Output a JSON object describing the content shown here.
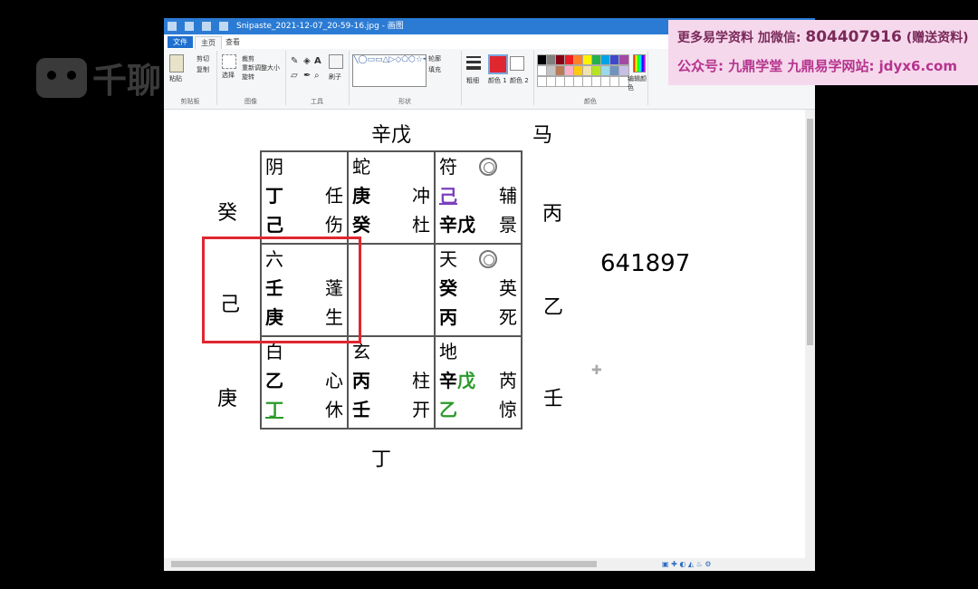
{
  "watermark": {
    "text": "千聊"
  },
  "window": {
    "title": "Snipaste_2021-12-07_20-59-16.jpg - 画图",
    "tabs": {
      "file": "文件",
      "home": "主页",
      "view": "查看"
    },
    "ribbon": {
      "clipboard": {
        "label": "剪贴板",
        "paste": "粘贴",
        "cut": "剪切",
        "copy": "复制"
      },
      "image": {
        "label": "图像",
        "select": "选择",
        "crop": "裁剪",
        "resize": "重新调整大小",
        "rotate": "旋转"
      },
      "tools": {
        "label": "工具",
        "brush": "刷子"
      },
      "shapes": {
        "label": "形状",
        "outline": "轮廓",
        "fill": "填充"
      },
      "size": "粗细",
      "color1": "颜色 1",
      "color2": "颜色 2",
      "colors": {
        "label": "颜色"
      },
      "edit_colors": "编辑颜色"
    }
  },
  "chart": {
    "top": "辛戊",
    "horse": "马",
    "left": {
      "top": "癸",
      "mid": "己",
      "bot": "庚"
    },
    "right": {
      "top": "丙",
      "mid": "乙",
      "bot": "壬"
    },
    "bottom": "丁",
    "number": "641897",
    "cells": {
      "r1c1": {
        "deity": "阴",
        "h1": "丁",
        "s1": "任",
        "h2": "己",
        "s2": "伤"
      },
      "r1c2": {
        "deity": "蛇",
        "h1": "庚",
        "s1": "冲",
        "h2": "癸",
        "s2": "杜"
      },
      "r1c3": {
        "deity": "符",
        "h1": "己",
        "s1": "辅",
        "h2": "辛戊",
        "s2": "景"
      },
      "r2c1": {
        "deity": "六",
        "h1": "壬",
        "s1": "蓬",
        "h2": "庚",
        "s2": "生"
      },
      "r2c3": {
        "deity": "天",
        "h1": "癸",
        "s1": "英",
        "h2": "丙",
        "s2": "死"
      },
      "r3c1": {
        "deity": "白",
        "h1": "乙",
        "s1": "心",
        "h2": "丁",
        "s2": "休"
      },
      "r3c2": {
        "deity": "玄",
        "h1": "丙",
        "s1": "柱",
        "h2": "壬",
        "s2": "开"
      },
      "r3c3": {
        "deity": "地",
        "h1a": "辛",
        "h1b": "戊",
        "s1": "芮",
        "h2": "乙",
        "s2": "惊"
      }
    }
  },
  "ad": {
    "line1_prefix": "更多易学资料 加微信:",
    "line1_number": "804407916",
    "line1_suffix": "(赠送资料)",
    "line2": "公众号: 九鼎学堂 九鼎易学网站: jdyx6.com"
  },
  "colors": {
    "accent": "#2b7bd4",
    "highlight": "#e0262f",
    "purple": "#7a3fbf",
    "green": "#2a9a2a"
  }
}
